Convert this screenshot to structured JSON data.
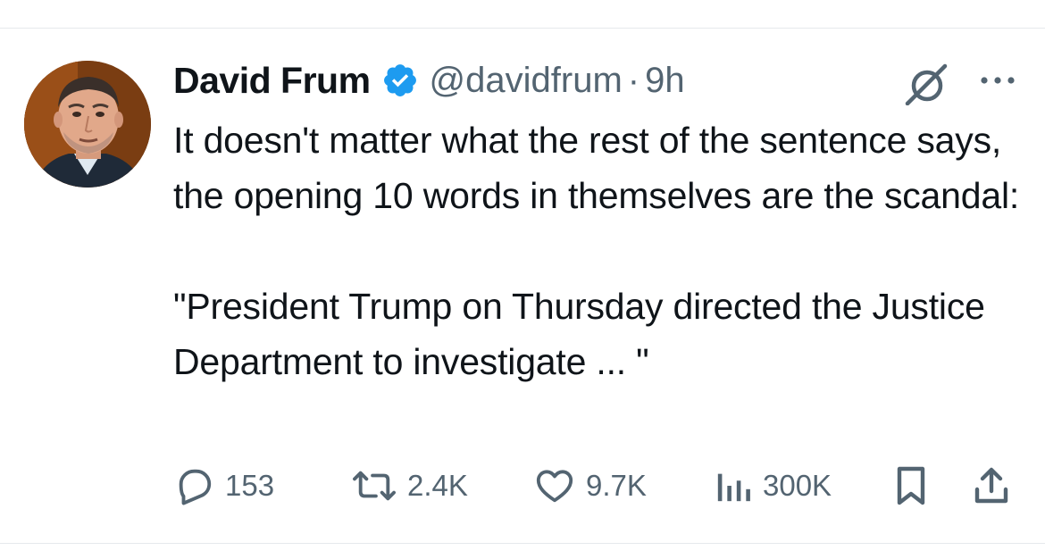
{
  "author": {
    "name": "David Frum",
    "handle": "@davidfrum",
    "separator": "·",
    "time": "9h",
    "verified": true
  },
  "tweet": {
    "text": "It doesn't matter what the rest of the sentence says, the opening 10 words in themselves are the scandal:\n\n\"President Trump on Thursday directed the Justice Department to investigate ... \""
  },
  "actions": {
    "replies": "153",
    "reposts": "2.4K",
    "likes": "9.7K",
    "views": "300K"
  },
  "icons": {
    "verified": "verified-badge-icon",
    "grok": "grok-icon",
    "more": "more-options-icon",
    "reply": "reply-icon",
    "repost": "repost-icon",
    "like": "heart-icon",
    "views": "views-icon",
    "bookmark": "bookmark-icon",
    "share": "share-icon"
  },
  "colors": {
    "text_primary": "#0f1419",
    "text_secondary": "#536471",
    "verified_blue": "#1d9bf0",
    "divider": "#e6e9ec"
  }
}
